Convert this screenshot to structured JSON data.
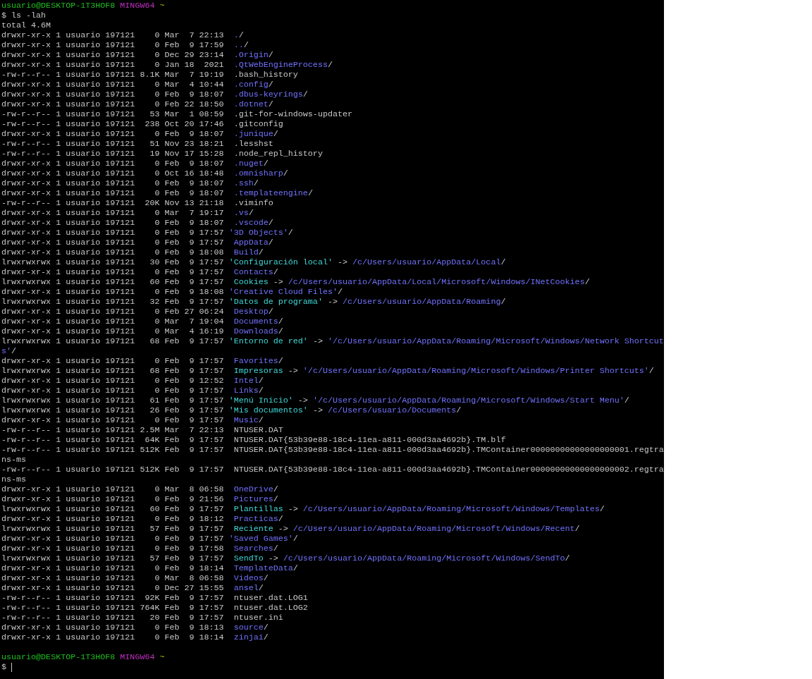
{
  "terminal": {
    "prompt": {
      "user": "usuario@DESKTOP-1T3HOF8",
      "system": "MINGW64",
      "path": "~"
    },
    "command_line": "$ ls -lah",
    "total": "total 4.6M",
    "entries": [
      {
        "kind": "dir",
        "info": "drwxr-xr-x 1 usuario 197121    0 Mar  7 22:13  ",
        "name": ".",
        "suffix": "/"
      },
      {
        "kind": "dir",
        "info": "drwxr-xr-x 1 usuario 197121    0 Feb  9 17:59  ",
        "name": "..",
        "suffix": "/"
      },
      {
        "kind": "dir",
        "info": "drwxr-xr-x 1 usuario 197121    0 Dec 29 23:14  ",
        "name": ".Origin",
        "suffix": "/"
      },
      {
        "kind": "dir",
        "info": "drwxr-xr-x 1 usuario 197121    0 Jan 18  2021  ",
        "name": ".QtWebEngineProcess",
        "suffix": "/"
      },
      {
        "kind": "file",
        "info": "-rw-r--r-- 1 usuario 197121 8.1K Mar  7 19:19  ",
        "name": ".bash_history"
      },
      {
        "kind": "dir",
        "info": "drwxr-xr-x 1 usuario 197121    0 Mar  4 10:44  ",
        "name": ".config",
        "suffix": "/"
      },
      {
        "kind": "dir",
        "info": "drwxr-xr-x 1 usuario 197121    0 Feb  9 18:07  ",
        "name": ".dbus-keyrings",
        "suffix": "/"
      },
      {
        "kind": "dir",
        "info": "drwxr-xr-x 1 usuario 197121    0 Feb 22 18:50  ",
        "name": ".dotnet",
        "suffix": "/"
      },
      {
        "kind": "file",
        "info": "-rw-r--r-- 1 usuario 197121   53 Mar  1 08:59  ",
        "name": ".git-for-windows-updater"
      },
      {
        "kind": "file",
        "info": "-rw-r--r-- 1 usuario 197121  238 Oct 20 17:46  ",
        "name": ".gitconfig"
      },
      {
        "kind": "dir",
        "info": "drwxr-xr-x 1 usuario 197121    0 Feb  9 18:07  ",
        "name": ".junique",
        "suffix": "/"
      },
      {
        "kind": "file",
        "info": "-rw-r--r-- 1 usuario 197121   51 Nov 23 18:21  ",
        "name": ".lesshst"
      },
      {
        "kind": "file",
        "info": "-rw-r--r-- 1 usuario 197121   19 Nov 17 15:28  ",
        "name": ".node_repl_history"
      },
      {
        "kind": "dir",
        "info": "drwxr-xr-x 1 usuario 197121    0 Feb  9 18:07  ",
        "name": ".nuget",
        "suffix": "/"
      },
      {
        "kind": "dir",
        "info": "drwxr-xr-x 1 usuario 197121    0 Oct 16 18:48  ",
        "name": ".omnisharp",
        "suffix": "/"
      },
      {
        "kind": "dir",
        "info": "drwxr-xr-x 1 usuario 197121    0 Feb  9 18:07  ",
        "name": ".ssh",
        "suffix": "/"
      },
      {
        "kind": "dir",
        "info": "drwxr-xr-x 1 usuario 197121    0 Feb  9 18:07  ",
        "name": ".templateengine",
        "suffix": "/"
      },
      {
        "kind": "file",
        "info": "-rw-r--r-- 1 usuario 197121  20K Nov 13 21:18  ",
        "name": ".viminfo"
      },
      {
        "kind": "dir",
        "info": "drwxr-xr-x 1 usuario 197121    0 Mar  7 19:17  ",
        "name": ".vs",
        "suffix": "/"
      },
      {
        "kind": "dir",
        "info": "drwxr-xr-x 1 usuario 197121    0 Feb  9 18:07  ",
        "name": ".vscode",
        "suffix": "/"
      },
      {
        "kind": "dir",
        "info": "drwxr-xr-x 1 usuario 197121    0 Feb  9 17:57 ",
        "name": "'3D Objects'",
        "suffix": "/"
      },
      {
        "kind": "dir",
        "info": "drwxr-xr-x 1 usuario 197121    0 Feb  9 17:57  ",
        "name": "AppData",
        "suffix": "/"
      },
      {
        "kind": "dir",
        "info": "drwxr-xr-x 1 usuario 197121    0 Feb  9 18:08  ",
        "name": "Build",
        "suffix": "/"
      },
      {
        "kind": "link",
        "info": "lrwxrwxrwx 1 usuario 197121   30 Feb  9 17:57 ",
        "name": "'Configuración local'",
        "arrow": "->",
        "target": "/c/Users/usuario/AppData/Local",
        "suffix": "/"
      },
      {
        "kind": "dir",
        "info": "drwxr-xr-x 1 usuario 197121    0 Feb  9 17:57  ",
        "name": "Contacts",
        "suffix": "/"
      },
      {
        "kind": "link",
        "info": "lrwxrwxrwx 1 usuario 197121   60 Feb  9 17:57  ",
        "name": "Cookies",
        "arrow": "->",
        "target": "/c/Users/usuario/AppData/Local/Microsoft/Windows/INetCookies",
        "suffix": "/"
      },
      {
        "kind": "dir",
        "info": "drwxr-xr-x 1 usuario 197121    0 Feb  9 18:08 ",
        "name": "'Creative Cloud Files'",
        "suffix": "/"
      },
      {
        "kind": "link",
        "info": "lrwxrwxrwx 1 usuario 197121   32 Feb  9 17:57 ",
        "name": "'Datos de programa'",
        "arrow": "->",
        "target": "/c/Users/usuario/AppData/Roaming",
        "suffix": "/"
      },
      {
        "kind": "dir",
        "info": "drwxr-xr-x 1 usuario 197121    0 Feb 27 06:24  ",
        "name": "Desktop",
        "suffix": "/"
      },
      {
        "kind": "dir",
        "info": "drwxr-xr-x 1 usuario 197121    0 Mar  7 19:04  ",
        "name": "Documents",
        "suffix": "/"
      },
      {
        "kind": "dir",
        "info": "drwxr-xr-x 1 usuario 197121    0 Mar  4 16:19  ",
        "name": "Downloads",
        "suffix": "/"
      },
      {
        "kind": "link",
        "info": "lrwxrwxrwx 1 usuario 197121   68 Feb  9 17:57 ",
        "name": "'Entorno de red'",
        "arrow": "->",
        "target": "'/c/Users/usuario/AppData/Roaming/Microsoft/Windows/Network Shortcuts'",
        "suffix": "/"
      },
      {
        "kind": "dir",
        "info": "drwxr-xr-x 1 usuario 197121    0 Feb  9 17:57  ",
        "name": "Favorites",
        "suffix": "/"
      },
      {
        "kind": "link",
        "info": "lrwxrwxrwx 1 usuario 197121   68 Feb  9 17:57  ",
        "name": "Impresoras",
        "arrow": "->",
        "target": "'/c/Users/usuario/AppData/Roaming/Microsoft/Windows/Printer Shortcuts'",
        "suffix": "/"
      },
      {
        "kind": "dir",
        "info": "drwxr-xr-x 1 usuario 197121    0 Feb  9 12:52  ",
        "name": "Intel",
        "suffix": "/"
      },
      {
        "kind": "dir",
        "info": "drwxr-xr-x 1 usuario 197121    0 Feb  9 17:57  ",
        "name": "Links",
        "suffix": "/"
      },
      {
        "kind": "link",
        "info": "lrwxrwxrwx 1 usuario 197121   61 Feb  9 17:57 ",
        "name": "'Menú Inicio'",
        "arrow": "->",
        "target": "'/c/Users/usuario/AppData/Roaming/Microsoft/Windows/Start Menu'",
        "suffix": "/"
      },
      {
        "kind": "link",
        "info": "lrwxrwxrwx 1 usuario 197121   26 Feb  9 17:57 ",
        "name": "'Mis documentos'",
        "arrow": "->",
        "target": "/c/Users/usuario/Documents",
        "suffix": "/"
      },
      {
        "kind": "dir",
        "info": "drwxr-xr-x 1 usuario 197121    0 Feb  9 17:57  ",
        "name": "Music",
        "suffix": "/"
      },
      {
        "kind": "file",
        "info": "-rw-r--r-- 1 usuario 197121 2.5M Mar  7 22:13  ",
        "name": "NTUSER.DAT"
      },
      {
        "kind": "file",
        "info": "-rw-r--r-- 1 usuario 197121  64K Feb  9 17:57  ",
        "name": "NTUSER.DAT{53b39e88-18c4-11ea-a811-000d3aa4692b}.TM.blf"
      },
      {
        "kind": "file",
        "info": "-rw-r--r-- 1 usuario 197121 512K Feb  9 17:57  ",
        "name": "NTUSER.DAT{53b39e88-18c4-11ea-a811-000d3aa4692b}.TMContainer00000000000000000001.regtrans-ms"
      },
      {
        "kind": "file",
        "info": "-rw-r--r-- 1 usuario 197121 512K Feb  9 17:57  ",
        "name": "NTUSER.DAT{53b39e88-18c4-11ea-a811-000d3aa4692b}.TMContainer00000000000000000002.regtrans-ms"
      },
      {
        "kind": "dir",
        "info": "drwxr-xr-x 1 usuario 197121    0 Mar  8 06:58  ",
        "name": "OneDrive",
        "suffix": "/"
      },
      {
        "kind": "dir",
        "info": "drwxr-xr-x 1 usuario 197121    0 Feb  9 21:56  ",
        "name": "Pictures",
        "suffix": "/"
      },
      {
        "kind": "link",
        "info": "lrwxrwxrwx 1 usuario 197121   60 Feb  9 17:57  ",
        "name": "Plantillas",
        "arrow": "->",
        "target": "/c/Users/usuario/AppData/Roaming/Microsoft/Windows/Templates",
        "suffix": "/"
      },
      {
        "kind": "dir",
        "info": "drwxr-xr-x 1 usuario 197121    0 Feb  9 18:12  ",
        "name": "Practicas",
        "suffix": "/"
      },
      {
        "kind": "link",
        "info": "lrwxrwxrwx 1 usuario 197121   57 Feb  9 17:57  ",
        "name": "Reciente",
        "arrow": "->",
        "target": "/c/Users/usuario/AppData/Roaming/Microsoft/Windows/Recent",
        "suffix": "/"
      },
      {
        "kind": "dir",
        "info": "drwxr-xr-x 1 usuario 197121    0 Feb  9 17:57 ",
        "name": "'Saved Games'",
        "suffix": "/"
      },
      {
        "kind": "dir",
        "info": "drwxr-xr-x 1 usuario 197121    0 Feb  9 17:58  ",
        "name": "Searches",
        "suffix": "/"
      },
      {
        "kind": "link",
        "info": "lrwxrwxrwx 1 usuario 197121   57 Feb  9 17:57  ",
        "name": "SendTo",
        "arrow": "->",
        "target": "/c/Users/usuario/AppData/Roaming/Microsoft/Windows/SendTo",
        "suffix": "/"
      },
      {
        "kind": "dir",
        "info": "drwxr-xr-x 1 usuario 197121    0 Feb  9 18:14  ",
        "name": "TemplateData",
        "suffix": "/"
      },
      {
        "kind": "dir",
        "info": "drwxr-xr-x 1 usuario 197121    0 Mar  8 06:58  ",
        "name": "Videos",
        "suffix": "/"
      },
      {
        "kind": "dir",
        "info": "drwxr-xr-x 1 usuario 197121    0 Dec 27 15:55  ",
        "name": "ansel",
        "suffix": "/"
      },
      {
        "kind": "file",
        "info": "-rw-r--r-- 1 usuario 197121  92K Feb  9 17:57  ",
        "name": "ntuser.dat.LOG1"
      },
      {
        "kind": "file",
        "info": "-rw-r--r-- 1 usuario 197121 764K Feb  9 17:57  ",
        "name": "ntuser.dat.LOG2"
      },
      {
        "kind": "file",
        "info": "-rw-r--r-- 1 usuario 197121   20 Feb  9 17:57  ",
        "name": "ntuser.ini"
      },
      {
        "kind": "dir",
        "info": "drwxr-xr-x 1 usuario 197121    0 Feb  9 18:13  ",
        "name": "source",
        "suffix": "/"
      },
      {
        "kind": "dir",
        "info": "drwxr-xr-x 1 usuario 197121    0 Feb  9 18:14  ",
        "name": "zinjai",
        "suffix": "/"
      }
    ],
    "final_prompt": {
      "user": "usuario@DESKTOP-1T3HOF8",
      "system": "MINGW64",
      "path": "~"
    },
    "input_line": {
      "symbol": "$",
      "cursor": true
    }
  }
}
